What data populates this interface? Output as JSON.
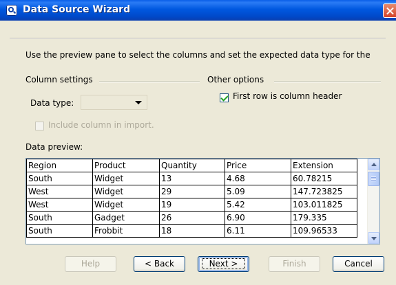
{
  "window": {
    "title": "Data Source Wizard"
  },
  "intro_text": "Use the preview pane to select the columns and set the expected data type for the",
  "column_settings": {
    "heading": "Column settings",
    "data_type_label": "Data type:",
    "data_type_value": "",
    "include_label": "Include column in import.",
    "include_checked": false
  },
  "other_options": {
    "heading": "Other options",
    "first_row_label": "First row is column header",
    "first_row_checked": true
  },
  "preview": {
    "label": "Data preview:",
    "rows": [
      [
        "Region",
        "Product",
        "Quantity",
        "Price",
        "Extension"
      ],
      [
        "South",
        "Widget",
        "13",
        "4.68",
        "60.78215"
      ],
      [
        "West",
        "Widget",
        "29",
        "5.09",
        "147.723825"
      ],
      [
        "West",
        "Widget",
        "19",
        "5.42",
        "103.011825"
      ],
      [
        "South",
        "Gadget",
        "26",
        "6.90",
        "179.335"
      ],
      [
        "South",
        "Frobbit",
        "18",
        "6.11",
        "109.96533"
      ]
    ]
  },
  "buttons": {
    "help": "Help",
    "back": "< Back",
    "next": "Next >",
    "finish": "Finish",
    "cancel": "Cancel"
  }
}
